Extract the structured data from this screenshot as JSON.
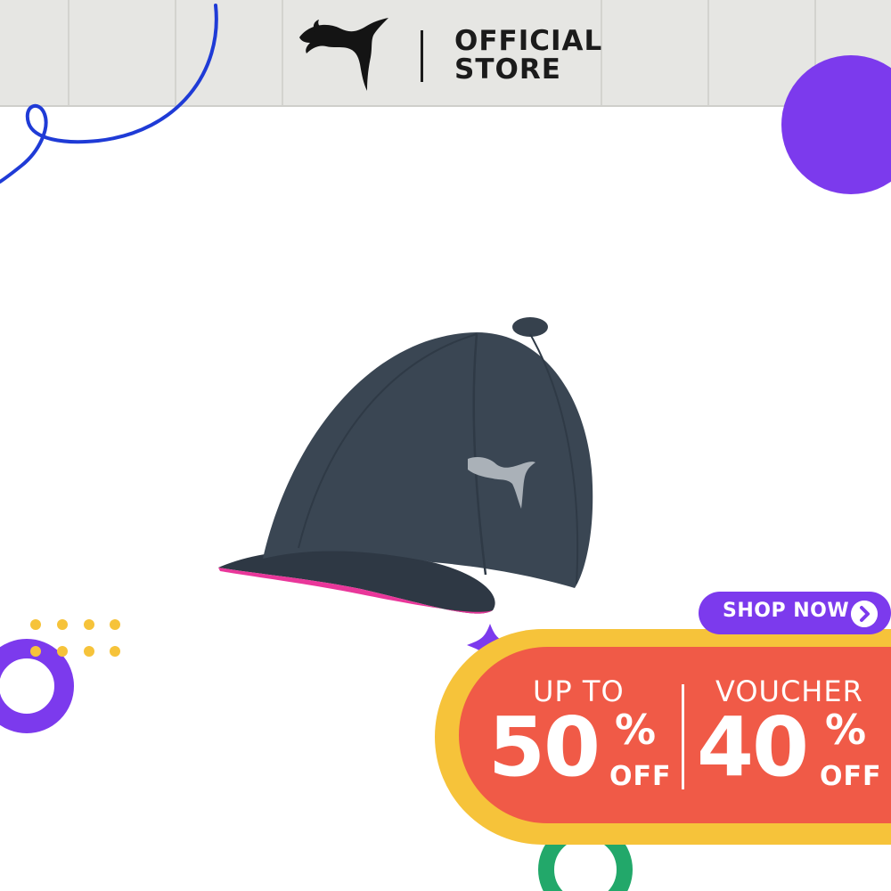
{
  "header": {
    "brand_logo": "puma-leaping-cat-logo",
    "store_line1": "OFFICIAL",
    "store_line2": "STORE"
  },
  "product": {
    "image": "navy-baseball-cap-with-pink-trim-and-silver-cat-logo"
  },
  "promo": {
    "shop_now": "SHOP NOW",
    "up_to": "UP TO",
    "discount_value": "50",
    "voucher": "VOUCHER",
    "voucher_value": "40",
    "percent": "%",
    "off": "OFF"
  },
  "colors": {
    "header_bg": "#e6e6e3",
    "purple": "#7c3aed",
    "blue_line": "#1f3bd6",
    "yellow": "#f6c33a",
    "red": "#f05a47",
    "green": "#22a86a",
    "cap_navy": "#3a4653",
    "cap_trim_pink": "#e9379a"
  },
  "icons": [
    "chevron-right-icon"
  ]
}
